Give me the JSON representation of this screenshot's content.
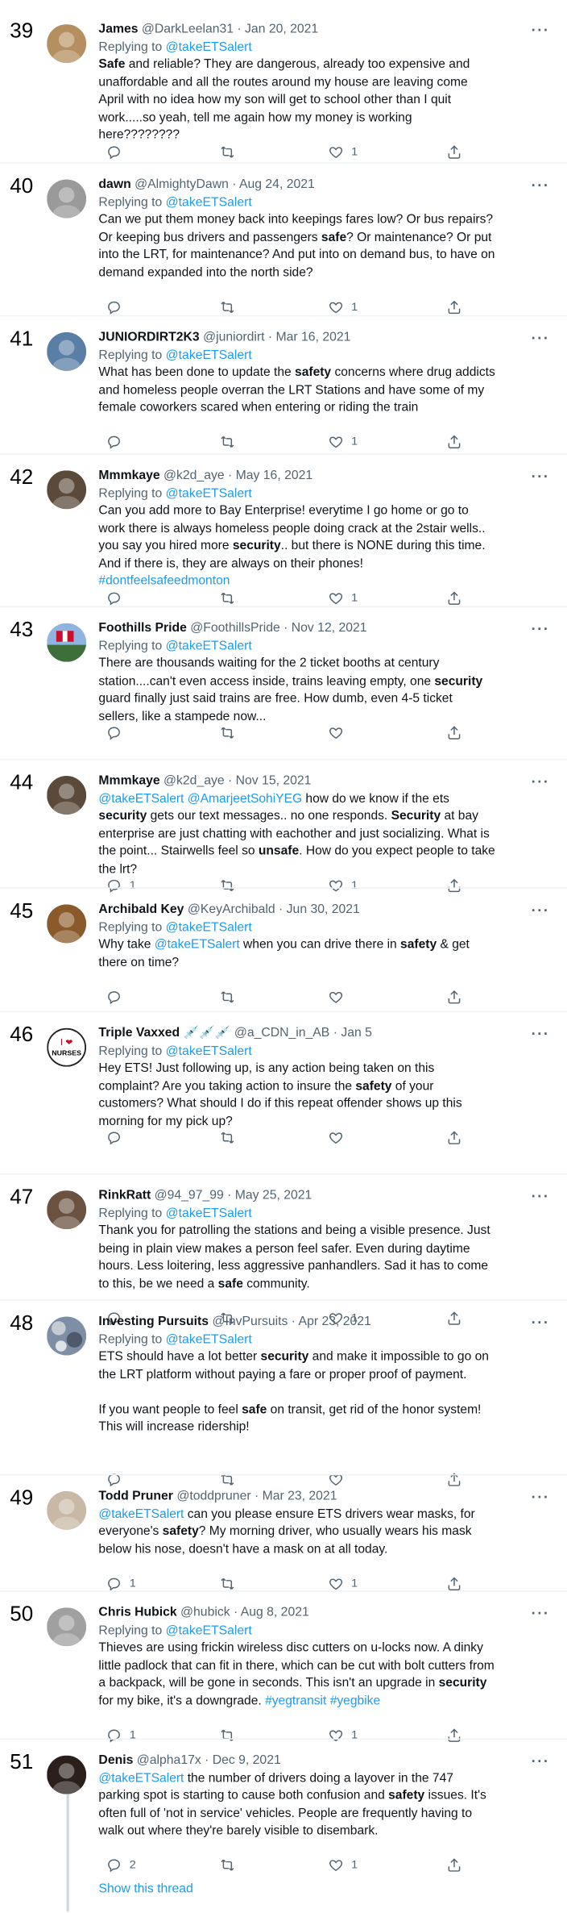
{
  "tweets": [
    {
      "num": "39",
      "name": "James",
      "handle": "@DarkLeelan31",
      "date": "Jan 20, 2021",
      "reply_prefix": "Replying to ",
      "reply_to": "@takeETSalert",
      "text_html": "<b>Safe</b> and reliable? They are dangerous, already too expensive and unaffordable and all the routes around my house are leaving come April with no idea how my son will get to school other than I quit work.....so yeah, tell me again how my money is working here????????",
      "replies": "",
      "likes": "1",
      "avatar": "dog"
    },
    {
      "num": "40",
      "name": "dawn",
      "handle": "@AlmightyDawn",
      "date": "Aug 24, 2021",
      "reply_prefix": "Replying to ",
      "reply_to": "@takeETSalert",
      "text_html": "Can we put them money back into keepings fares low? Or bus repairs? Or keeping bus drivers and passengers <b>safe</b>? Or maintenance? Or put into the LRT, for maintenance? And put into on demand bus, to have on demand expanded into the north side?",
      "replies": "",
      "likes": "1",
      "avatar": "person-bw"
    },
    {
      "num": "41",
      "name": "JUNIORDIRT2K3",
      "handle": "@juniordirt",
      "date": "Mar 16, 2021",
      "reply_prefix": "Replying to ",
      "reply_to": "@takeETSalert",
      "text_html": "What has been done to update the <b>safety</b> concerns where drug addicts and homeless people overran the LRT Stations and have some of my female coworkers scared when entering or riding the train",
      "replies": "",
      "likes": "1",
      "avatar": "person-glasses"
    },
    {
      "num": "42",
      "name": "Mmmkaye",
      "handle": "@k2d_aye",
      "date": "May 16, 2021",
      "reply_prefix": "Replying to ",
      "reply_to": "@takeETSalert",
      "text_html": "Can you add more to Bay Enterprise! everytime I go home or go to work there is always homeless people doing crack at the 2stair wells.. you say you hired more <b>security</b>.. but there is NONE during this time.  And if there is, they are always on their phones! <span class=\"mention\">#dontfeelsafeedmonton</span>",
      "replies": "",
      "likes": "1",
      "avatar": "cat"
    },
    {
      "num": "43",
      "name": "Foothills Pride",
      "handle": "@FoothillsPride",
      "date": "Nov 12, 2021",
      "reply_prefix": "Replying to ",
      "reply_to": "@takeETSalert",
      "text_html": "There are thousands waiting for the 2 ticket booths at century station....can't even access inside, trains leaving empty, one <b>security</b> guard finally just said trains are free.  How dumb, even 4-5 ticket sellers, like a stampede now...",
      "replies": "",
      "likes": "",
      "avatar": "flag"
    },
    {
      "num": "44",
      "name": "Mmmkaye",
      "handle": "@k2d_aye",
      "date": "Nov 15, 2021",
      "reply_prefix": "",
      "reply_to": "",
      "text_html": "<span class=\"mention\">@takeETSalert</span> <span class=\"mention\">@AmarjeetSohiYEG</span> how do we know if the ets <b>security</b> gets our text messages.. no one responds. <b>Security</b> at bay enterprise are just chatting with eachother and just socializing. What is the point... Stairwells feel so <b>unsafe</b>. How do you expect people to take the lrt?",
      "replies": "1",
      "likes": "1",
      "avatar": "cat"
    },
    {
      "num": "45",
      "name": "Archibald Key",
      "handle": "@KeyArchibald",
      "date": "Jun 30, 2021",
      "reply_prefix": "Replying to ",
      "reply_to": "@takeETSalert",
      "text_html": "Why take <span class=\"mention\">@takeETSalert</span> when you can drive there in <b>safety</b> &amp; get there on time?",
      "replies": "",
      "likes": "",
      "avatar": "dog2"
    },
    {
      "num": "46",
      "name": "Triple Vaxxed 💉💉💉",
      "handle": "@a_CDN_in_AB",
      "date": "Jan 5",
      "reply_prefix": "Replying to ",
      "reply_to": "@takeETSalert",
      "text_html": "Hey ETS! Just following up, is any action being taken on this complaint? Are you taking action to insure the <b>safety</b> of your customers? What should I do if this repeat offender shows up this morning for my pick up?",
      "replies": "",
      "likes": "",
      "avatar": "nurses",
      "avatar_text_top": "I ❤",
      "avatar_text_bottom": "NURSES"
    },
    {
      "num": "47",
      "name": "RinkRatt",
      "handle": "@94_97_99",
      "date": "May 25, 2021",
      "reply_prefix": "Replying to ",
      "reply_to": "@takeETSalert",
      "text_html": "Thank you for patrolling the stations and being a visible presence. Just being in plain view makes a person feel safer. Even during daytime hours. Less loitering, less aggressive panhandlers. Sad it has to come to this, be we need a <b>safe</b> community.",
      "replies": "",
      "likes": "1",
      "avatar": "person-hat"
    },
    {
      "num": "48",
      "name": "Investing Pursuits",
      "handle": "@InvPursuits",
      "date": "Apr 23, 2021",
      "reply_prefix": "Replying to ",
      "reply_to": "@takeETSalert",
      "text_html": "ETS should have a lot better <b>security</b> and make it impossible to go on the LRT platform without paying a fare or proper proof of payment.<br><br>If you want people to feel <b>safe</b> on transit, get rid of the honor system!   This will increase ridership!",
      "replies": "",
      "likes": "",
      "avatar": "pattern"
    },
    {
      "num": "49",
      "name": "Todd Pruner",
      "handle": "@toddpruner",
      "date": "Mar 23, 2021",
      "reply_prefix": "",
      "reply_to": "",
      "text_html": "<span class=\"mention\">@takeETSalert</span> can you please ensure ETS drivers wear masks, for everyone's <b>safety</b>? My morning driver, who usually wears his mask below his nose, doesn't have a mask on at all today.",
      "replies": "1",
      "likes": "1",
      "avatar": "person-mask"
    },
    {
      "num": "50",
      "name": "Chris Hubick",
      "handle": "@hubick",
      "date": "Aug 8, 2021",
      "reply_prefix": "Replying to ",
      "reply_to": "@takeETSalert",
      "text_html": "Thieves are using frickin wireless disc cutters on u-locks now. A dinky little padlock that can fit in there, which can be cut with bolt cutters from a backpack, will be gone in seconds. This isn't an upgrade in <b>security</b> for my bike, it's a downgrade. <span class=\"mention\">#yegtransit</span> <span class=\"mention\">#yegbike</span>",
      "replies": "1",
      "likes": "1",
      "avatar": "person-bald"
    },
    {
      "num": "51",
      "name": "Denis",
      "handle": "@alpha17x",
      "date": "Dec 9, 2021",
      "reply_prefix": "",
      "reply_to": "",
      "text_html": "<span class=\"mention\">@takeETSalert</span> the number of drivers doing a layover in the 747 parking spot is starting to cause both confusion and <b>safety</b> issues. It's often full of 'not in service' vehicles. People are frequently having to walk out where they're barely visible to disembark.",
      "replies": "2",
      "likes": "1",
      "avatar": "person-dark"
    }
  ],
  "show_thread": "Show this thread",
  "more_label": "···",
  "colors": {
    "accent": "#1d9bf0",
    "muted": "#536471",
    "text": "#0f1419",
    "border": "#eff3f4"
  }
}
